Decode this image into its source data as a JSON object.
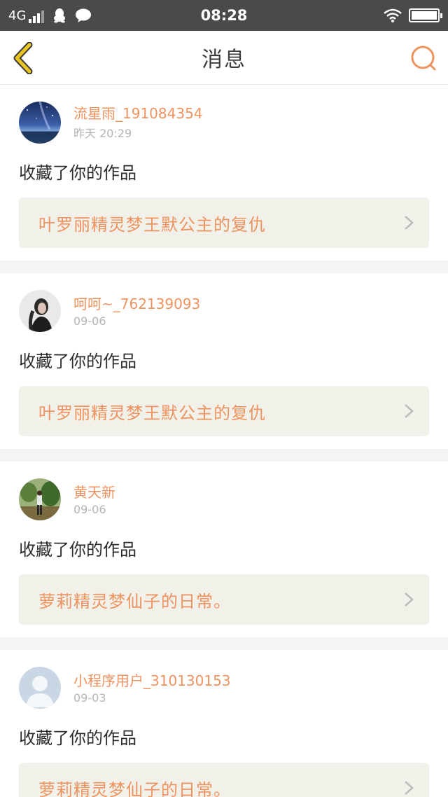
{
  "status_bar": {
    "network": "4G",
    "time": "08:28",
    "icons": [
      "signal-icon",
      "qq-penguin-icon",
      "chat-bubble-icon",
      "wifi-icon",
      "battery-icon"
    ]
  },
  "header": {
    "title": "消息",
    "back_icon": "back-chevron-icon",
    "search_icon": "search-icon"
  },
  "colors": {
    "accent": "#ee9360",
    "back_icon": "#e8c520",
    "card_link_bg": "#f1f1e9"
  },
  "messages": [
    {
      "username": "流星雨_191084354",
      "time": "昨天 20:29",
      "action": "收藏了你的作品",
      "work_title": "叶罗丽精灵梦王默公主的复仇"
    },
    {
      "username": "呵呵~_762139093",
      "time": "09-06",
      "action": "收藏了你的作品",
      "work_title": "叶罗丽精灵梦王默公主的复仇"
    },
    {
      "username": "黄天新",
      "time": "09-06",
      "action": "收藏了你的作品",
      "work_title": "萝莉精灵梦仙子的日常。"
    },
    {
      "username": "小程序用户_310130153",
      "time": "09-03",
      "action": "收藏了你的作品",
      "work_title": "萝莉精灵梦仙子的日常。"
    }
  ]
}
